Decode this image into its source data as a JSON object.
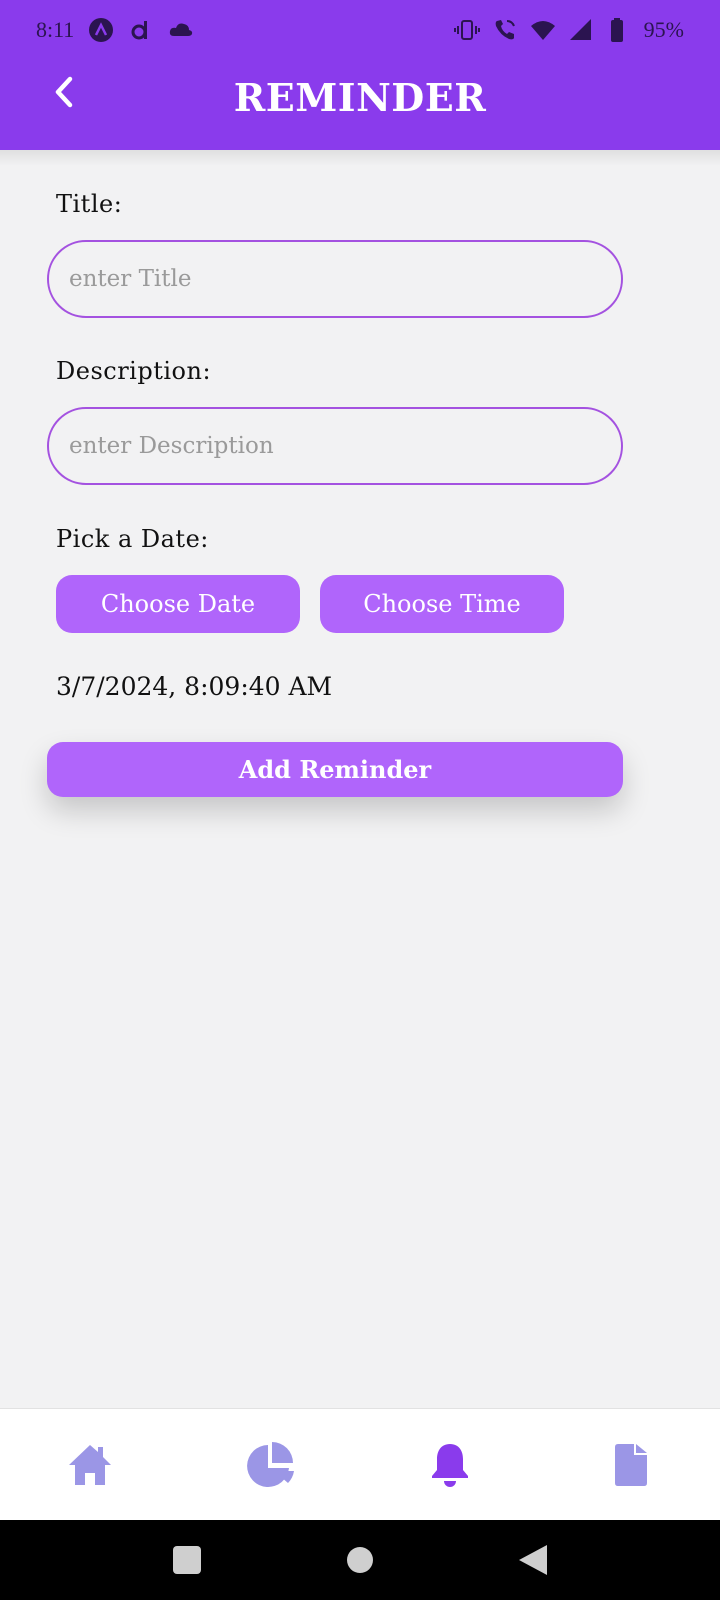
{
  "status_bar": {
    "time": "8:11",
    "battery": "95%",
    "left_icons": [
      "app-a-icon",
      "app-d-icon",
      "cloud-icon"
    ],
    "right_icons": [
      "vibrate-icon",
      "wifi-call-icon",
      "wifi-icon",
      "signal-icon",
      "battery-icon"
    ]
  },
  "header": {
    "title": "REMINDER",
    "back_icon": "chevron-left-icon",
    "color": "#8a3bec"
  },
  "form": {
    "title_label": "Title:",
    "title_placeholder": "enter Title",
    "title_value": "",
    "description_label": "Description:",
    "description_placeholder": "enter Description",
    "description_value": "",
    "date_label": "Pick a Date:",
    "choose_date": "Choose Date",
    "choose_time": "Choose Time",
    "selected_datetime": "3/7/2024, 8:09:40 AM",
    "add_button": "Add Reminder",
    "accent": "#b065fb"
  },
  "bottom_nav": {
    "items": [
      {
        "icon": "home-icon",
        "active": false
      },
      {
        "icon": "pie-chart-icon",
        "active": false
      },
      {
        "icon": "bell-icon",
        "active": true
      },
      {
        "icon": "document-icon",
        "active": false
      }
    ],
    "inactive_color": "#9b96e6",
    "active_color": "#8a3bec"
  },
  "system_nav": {
    "items": [
      "recents-icon",
      "home-circle-icon",
      "back-triangle-icon"
    ]
  }
}
